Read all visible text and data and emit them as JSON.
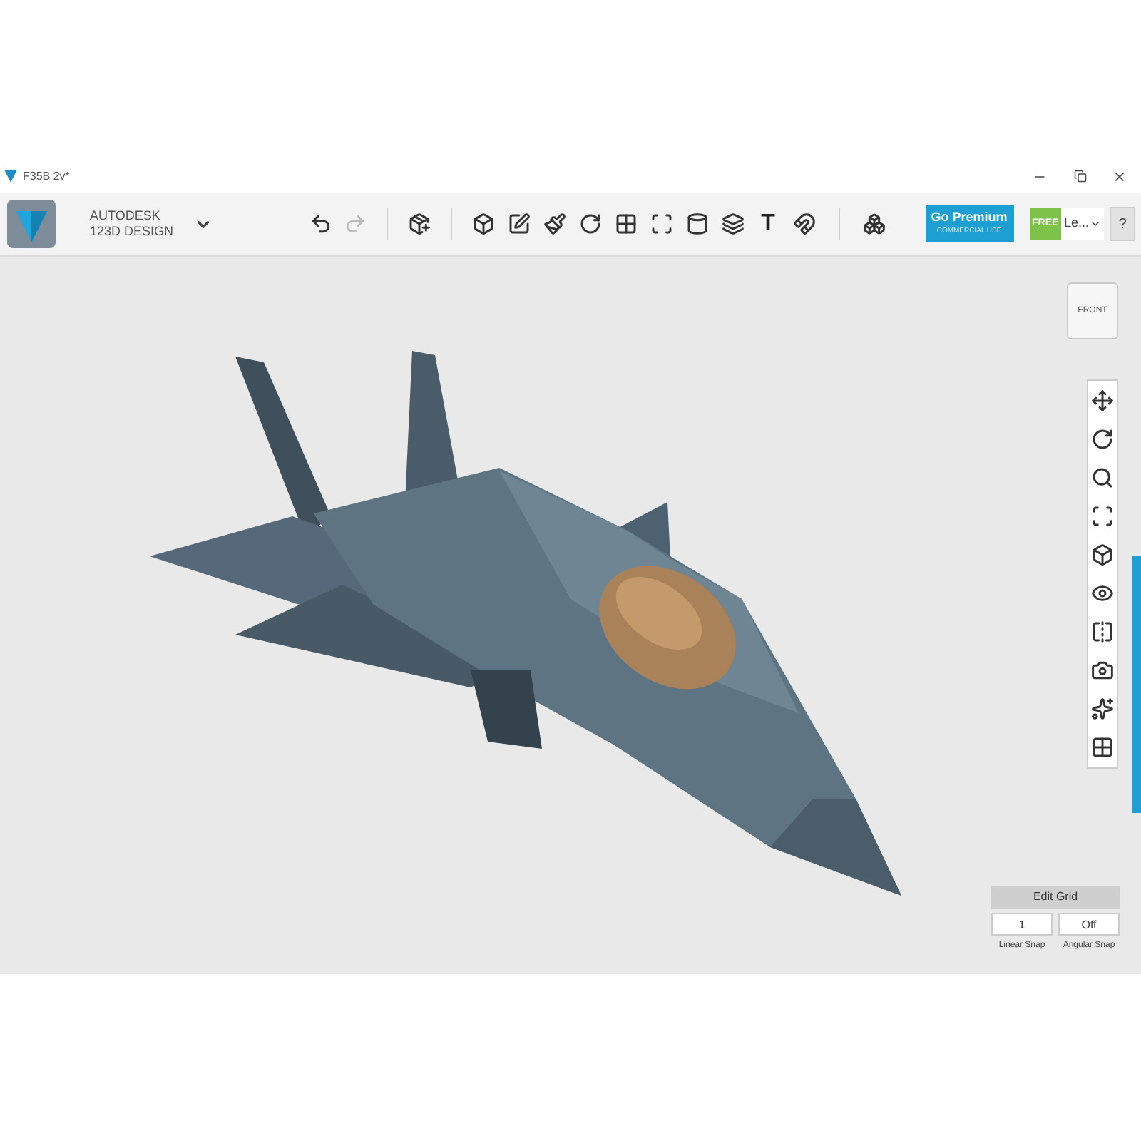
{
  "window": {
    "title": "F35B 2v*"
  },
  "logo": {
    "line_1": "AUTODESK",
    "line_2": "123D DESIGN"
  },
  "premium": {
    "title": "Go Premium",
    "subtitle": "COMMERCIAL USE"
  },
  "badge": {
    "label": "FREE"
  },
  "account": {
    "label": "Le..."
  },
  "help": {
    "label": "?"
  },
  "text_tool": {
    "label": "T"
  },
  "view_cube": {
    "face": "FRONT"
  },
  "grid": {
    "button": "Edit Grid",
    "linear_value": "1",
    "angular_value": "Off",
    "linear_label": "Linear Snap",
    "angular_label": "Angular Snap"
  }
}
